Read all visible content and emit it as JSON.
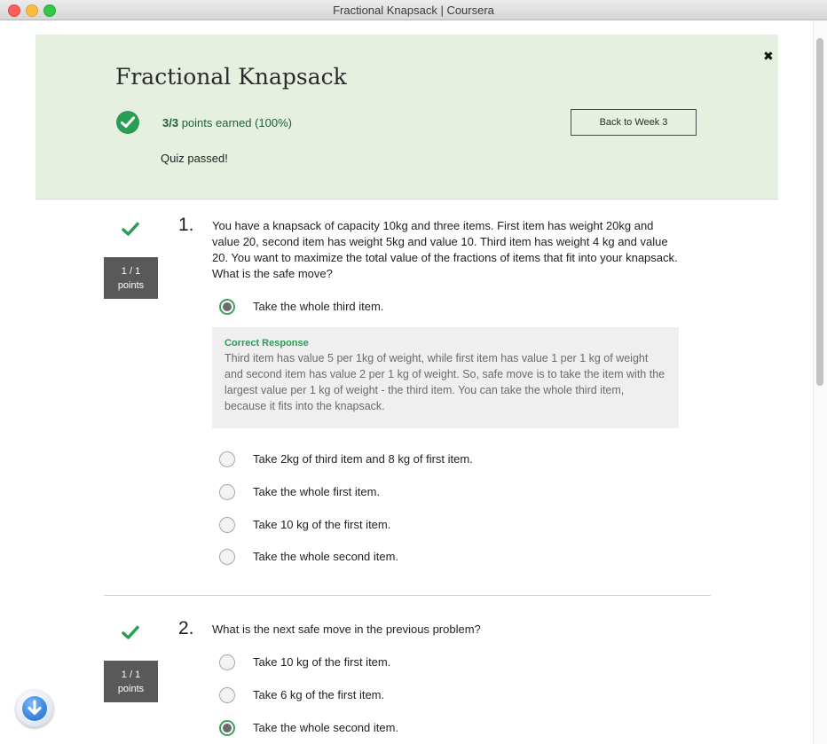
{
  "window": {
    "title": "Fractional Knapsack | Coursera"
  },
  "header": {
    "title": "Fractional Knapsack",
    "score_bold": "3/3",
    "score_rest": "points earned (100%)",
    "status": "Quiz passed!",
    "back_button": "Back to Week 3",
    "close_symbol": "✖"
  },
  "questions": [
    {
      "number": "1.",
      "points_line1": "1 / 1",
      "points_line2": "points",
      "text": "You have a knapsack of capacity 10kg and three items. First item has weight 20kg and value 20, second item has weight 5kg and value 10. Third item has weight 4 kg and value 20. You want to maximize the total value of the fractions of items that fit into your knapsack. What is the safe move?",
      "options": [
        {
          "label": "Take the whole third item.",
          "selected": true
        },
        {
          "label": "Take 2kg of third item and 8 kg of first item.",
          "selected": false
        },
        {
          "label": "Take the whole first item.",
          "selected": false
        },
        {
          "label": "Take 10 kg of the first item.",
          "selected": false
        },
        {
          "label": "Take the whole second item.",
          "selected": false
        }
      ],
      "feedback": {
        "title": "Correct Response",
        "text": "Third item has value 5 per 1kg of weight, while first item has value 1 per 1 kg of weight and second item has value 2 per 1 kg of weight. So, safe move is to take the item with the largest value per 1 kg of weight - the third item. You can take the whole third item, because it fits into the knapsack."
      }
    },
    {
      "number": "2.",
      "points_line1": "1 / 1",
      "points_line2": "points",
      "text": "What is the next safe move in the previous problem?",
      "options": [
        {
          "label": "Take 10 kg of the first item.",
          "selected": false
        },
        {
          "label": "Take 6 kg of the first item.",
          "selected": false
        },
        {
          "label": "Take the whole second item.",
          "selected": true
        }
      ]
    }
  ],
  "colors": {
    "accent_green": "#2a9d55",
    "header_bg": "#e6f0e1",
    "badge_bg": "#595959"
  },
  "icons": [
    "check-circle-icon",
    "checkmark-icon",
    "close-icon",
    "download-arrow-icon"
  ]
}
